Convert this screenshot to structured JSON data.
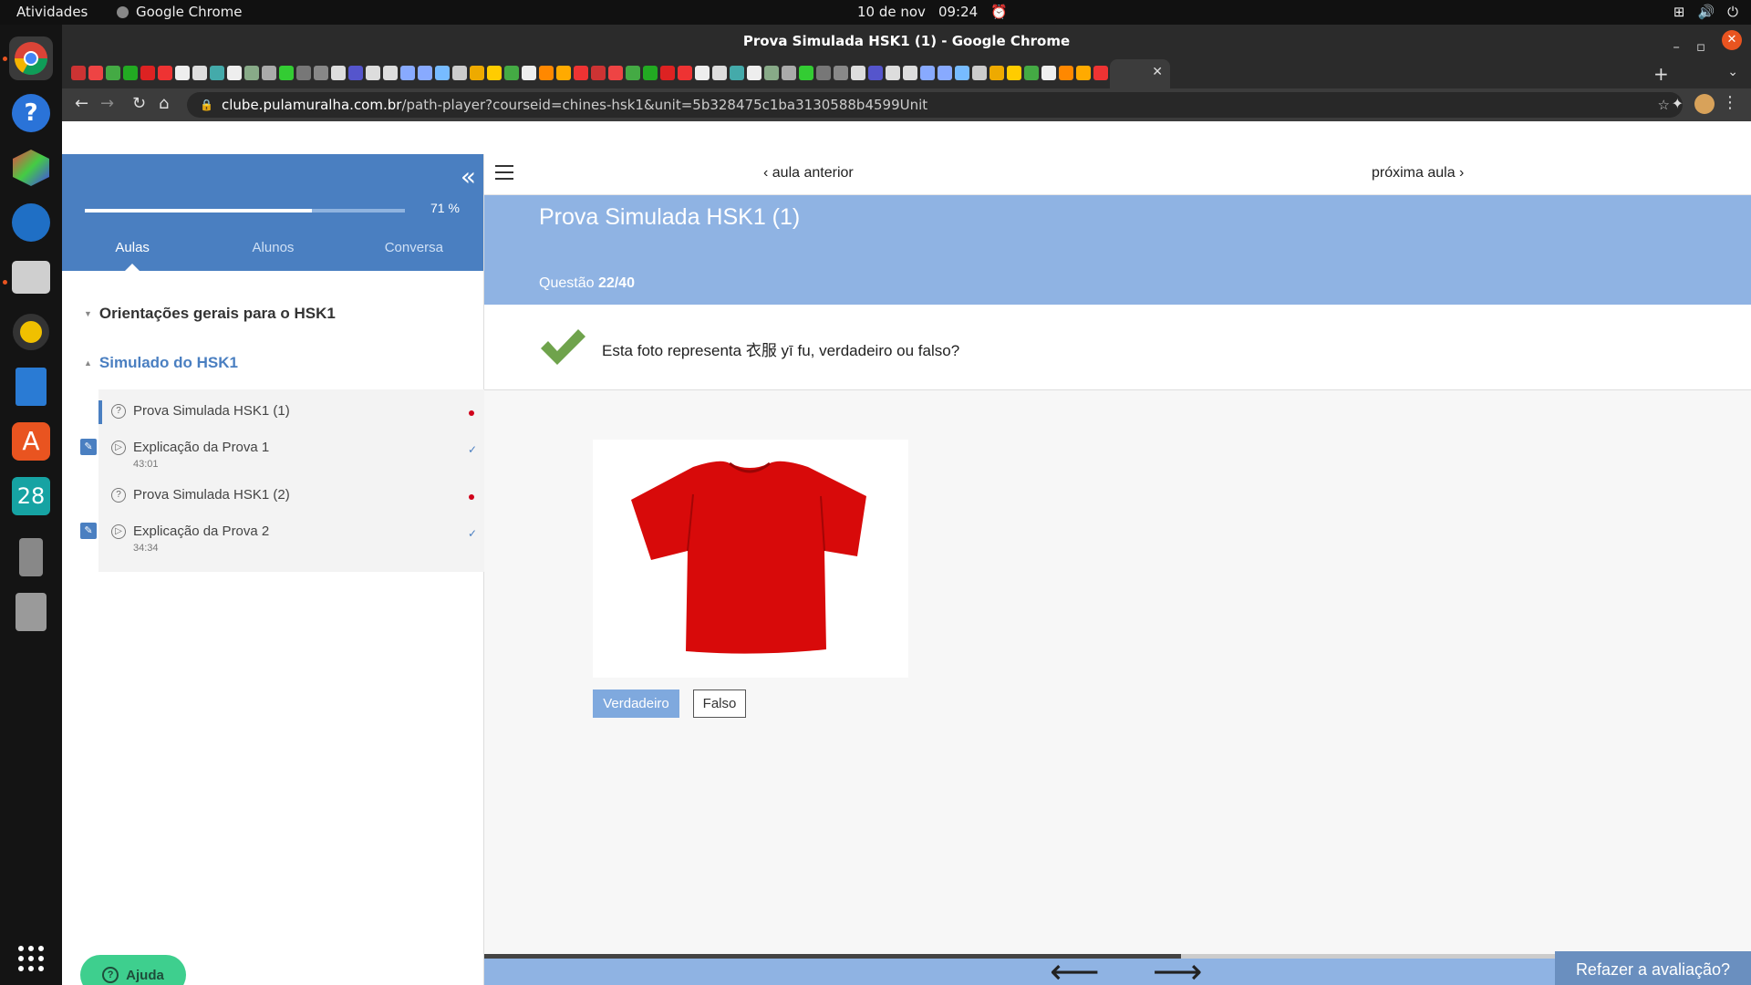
{
  "os": {
    "activities": "Atividades",
    "app_name": "Google Chrome",
    "date": "10 de nov",
    "time": "09:24"
  },
  "window": {
    "title": "Prova Simulada HSK1 (1) - Google Chrome"
  },
  "address_bar": {
    "host": "clube.pulamuralha.com.br",
    "path": "/path-player?courseid=chines-hsk1&unit=5b328475c1ba3130588b4599Unit"
  },
  "sidebar": {
    "progress_label": "71 %",
    "progress_value": 0.71,
    "tabs": [
      "Aulas",
      "Alunos",
      "Conversa"
    ],
    "sections": [
      {
        "title": "Orientações gerais para o HSK1"
      },
      {
        "title": "Simulado do HSK1"
      }
    ],
    "lessons": [
      {
        "title": "Prova Simulada HSK1 (1)",
        "duration": "",
        "status": "incomplete"
      },
      {
        "title": "Explicação da Prova 1",
        "duration": "43:01",
        "status": "complete"
      },
      {
        "title": "Prova Simulada HSK1 (2)",
        "duration": "",
        "status": "incomplete"
      },
      {
        "title": "Explicação da Prova 2",
        "duration": "34:34",
        "status": "complete"
      }
    ],
    "help_label": "Ajuda"
  },
  "lesson_nav": {
    "prev": "aula anterior",
    "next": "próxima aula"
  },
  "quiz": {
    "title": "Prova Simulada HSK1 (1)",
    "counter_label": "Questão",
    "counter_value": "22/40",
    "question": "Esta foto representa 衣服 yī fu, verdadeiro ou falso?",
    "options": [
      "Verdadeiro",
      "Falso"
    ],
    "selected_option": "Verdadeiro",
    "redo_label": "Refazer a avaliação?",
    "quiz_progress": 0.55
  },
  "colors": {
    "sidebar_blue": "#4a7fc1",
    "header_blue": "#8fb3e3",
    "check_green": "#6fa34c",
    "shirt_red": "#d80a0a"
  }
}
